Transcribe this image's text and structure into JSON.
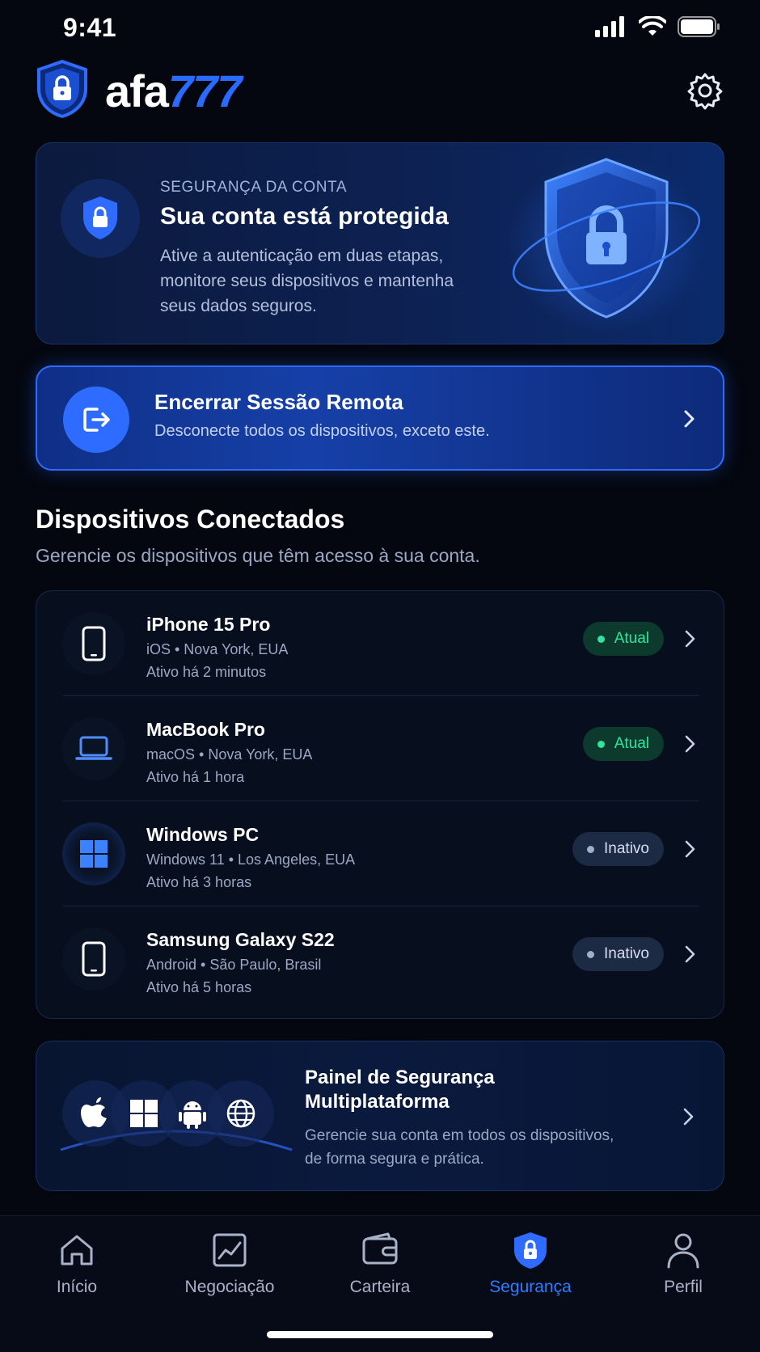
{
  "status": {
    "time": "9:41"
  },
  "brand": {
    "part1": "afa",
    "part2": "777"
  },
  "hero": {
    "eyebrow": "SEGURANÇA DA CONTA",
    "title": "Sua conta está protegida",
    "description": "Ative a autenticação em duas etapas, monitore seus dispositivos e mantenha seus dados seguros."
  },
  "remote": {
    "title": "Encerrar Sessão Remota",
    "subtitle": "Desconecte todos os dispositivos, exceto este."
  },
  "section": {
    "title": "Dispositivos Conectados",
    "subtitle": "Gerencie os dispositivos que têm acesso à sua conta."
  },
  "devices": [
    {
      "name": "iPhone 15 Pro",
      "meta": "iOS • Nova York, EUA",
      "active": "Ativo há 2 minutos",
      "status": "Atual",
      "icon": "phone-icon"
    },
    {
      "name": "MacBook Pro",
      "meta": "macOS • Nova York, EUA",
      "active": "Ativo há 1 hora",
      "status": "Atual",
      "icon": "laptop-icon"
    },
    {
      "name": "Windows PC",
      "meta": "Windows 11 • Los Angeles, EUA",
      "active": "Ativo há 3 horas",
      "status": "Inativo",
      "icon": "windows-icon"
    },
    {
      "name": "Samsung Galaxy S22",
      "meta": "Android • São Paulo, Brasil",
      "active": "Ativo há 5 horas",
      "status": "Inativo",
      "icon": "phone-icon"
    }
  ],
  "multi": {
    "title": "Painel de Segurança Multiplataforma",
    "description": "Gerencie sua conta em todos os dispositivos, de forma segura e prática.",
    "platforms": [
      "apple-icon",
      "windows-icon",
      "android-icon",
      "globe-icon"
    ]
  },
  "tabs": [
    {
      "label": "Início",
      "icon": "home-icon"
    },
    {
      "label": "Negociação",
      "icon": "chart-icon"
    },
    {
      "label": "Carteira",
      "icon": "wallet-icon"
    },
    {
      "label": "Segurança",
      "icon": "shield-lock-icon",
      "active": true
    },
    {
      "label": "Perfil",
      "icon": "user-icon"
    }
  ],
  "colors": {
    "accent": "#2f7bff",
    "success": "#2ee59d",
    "background": "#04070f"
  }
}
